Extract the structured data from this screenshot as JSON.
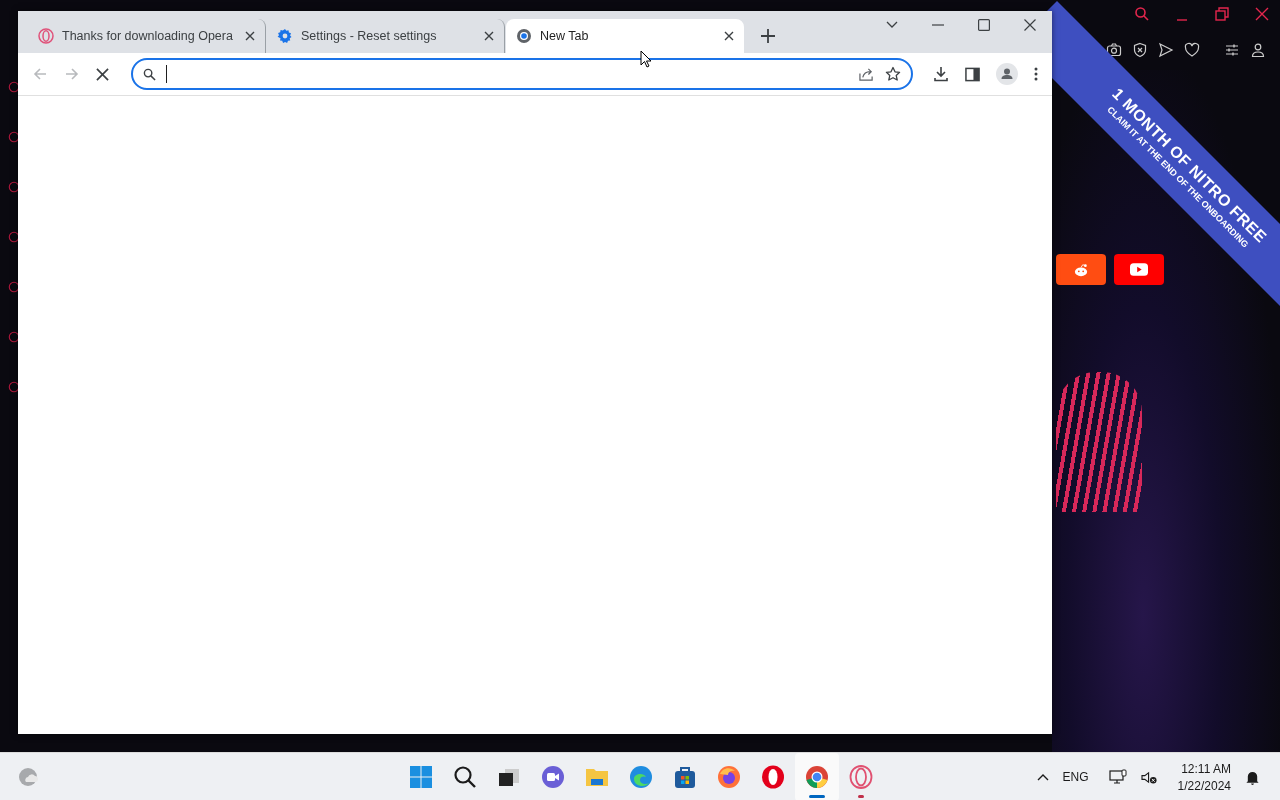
{
  "background_window": {
    "banner": {
      "title": "1 MONTH OF NITRO FREE",
      "subtitle": "CLAIM IT AT THE END OF THE ONBOARDING"
    },
    "speed_dials": [
      {
        "kind": "reddit"
      },
      {
        "kind": "youtube"
      }
    ]
  },
  "browser": {
    "tabs": [
      {
        "title": "Thanks for downloading Opera",
        "kind": "opera",
        "selected": false
      },
      {
        "title": "Settings - Reset settings",
        "kind": "gear",
        "selected": false
      },
      {
        "title": "New Tab",
        "kind": "chrome",
        "selected": true
      }
    ],
    "loading": true
  },
  "taskbar": {
    "apps": [
      {
        "kind": "start",
        "active": false,
        "running": false
      },
      {
        "kind": "search",
        "active": false,
        "running": false
      },
      {
        "kind": "taskview",
        "active": false,
        "running": false
      },
      {
        "kind": "meet",
        "active": false,
        "running": false
      },
      {
        "kind": "files",
        "active": false,
        "running": false
      },
      {
        "kind": "edge",
        "active": false,
        "running": false
      },
      {
        "kind": "store",
        "active": false,
        "running": false
      },
      {
        "kind": "firefox",
        "active": false,
        "running": false
      },
      {
        "kind": "opera",
        "active": false,
        "running": false
      },
      {
        "kind": "chrome",
        "active": true,
        "running": true
      },
      {
        "kind": "operagx",
        "active": false,
        "running": true
      }
    ],
    "language": "ENG",
    "time": "12:11 AM",
    "date": "1/22/2024"
  }
}
